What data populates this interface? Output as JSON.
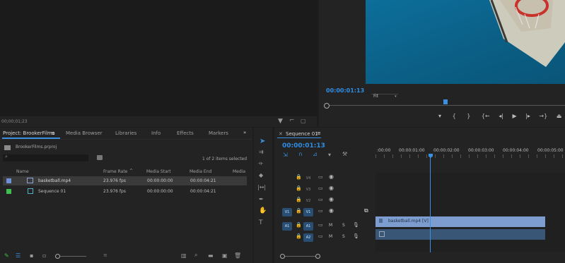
{
  "source_monitor": {
    "timecode": "00;00;01;23"
  },
  "program_monitor": {
    "timecode": "00:00:01:13",
    "fit_label": "Fit"
  },
  "project": {
    "tabs": [
      "Project: BrookerFilms",
      "Media Browser",
      "Libraries",
      "Info",
      "Effects",
      "Markers"
    ],
    "project_file": "BrookerFilms.prproj",
    "selection_status": "1 of 2 items selected",
    "columns": [
      "Name",
      "Frame Rate",
      "Media Start",
      "Media End",
      "Media"
    ],
    "rows": [
      {
        "name": "basketball.mp4",
        "frame_rate": "23.976 fps",
        "media_start": "00:00:00:00",
        "media_end": "00:00:04:21",
        "color": "#6f8fd6",
        "selected": true
      },
      {
        "name": "Sequence 01",
        "frame_rate": "23.976 fps",
        "media_start": "00:00:00:00",
        "media_end": "00:00:04:21",
        "color": "#3fbf4f",
        "selected": false
      }
    ]
  },
  "timeline": {
    "sequence_tab": "Sequence 01",
    "timecode": "00:00:01:13",
    "ruler_labels": [
      ":00:00",
      "00:00:01:00",
      "00:00:02:00",
      "00:00:03:00",
      "00:00:04:00",
      "00:00:05:00"
    ],
    "tracks": [
      {
        "target": "",
        "label": "V4",
        "kind": "video"
      },
      {
        "target": "",
        "label": "V3",
        "kind": "video"
      },
      {
        "target": "",
        "label": "V2",
        "kind": "video"
      },
      {
        "target": "V1",
        "label": "V1",
        "kind": "video"
      },
      {
        "target": "A1",
        "label": "A1",
        "kind": "audio"
      },
      {
        "target": "",
        "label": "A2",
        "kind": "audio"
      }
    ],
    "video_clip_label": "basketball.mp4 [V]",
    "mute_label": "M",
    "solo_label": "S"
  },
  "colors": {
    "accent": "#2f8ee6",
    "video_clip": "#7d9dd0",
    "audio_clip": "#3a5676",
    "playhead": "#3b8fe0"
  }
}
